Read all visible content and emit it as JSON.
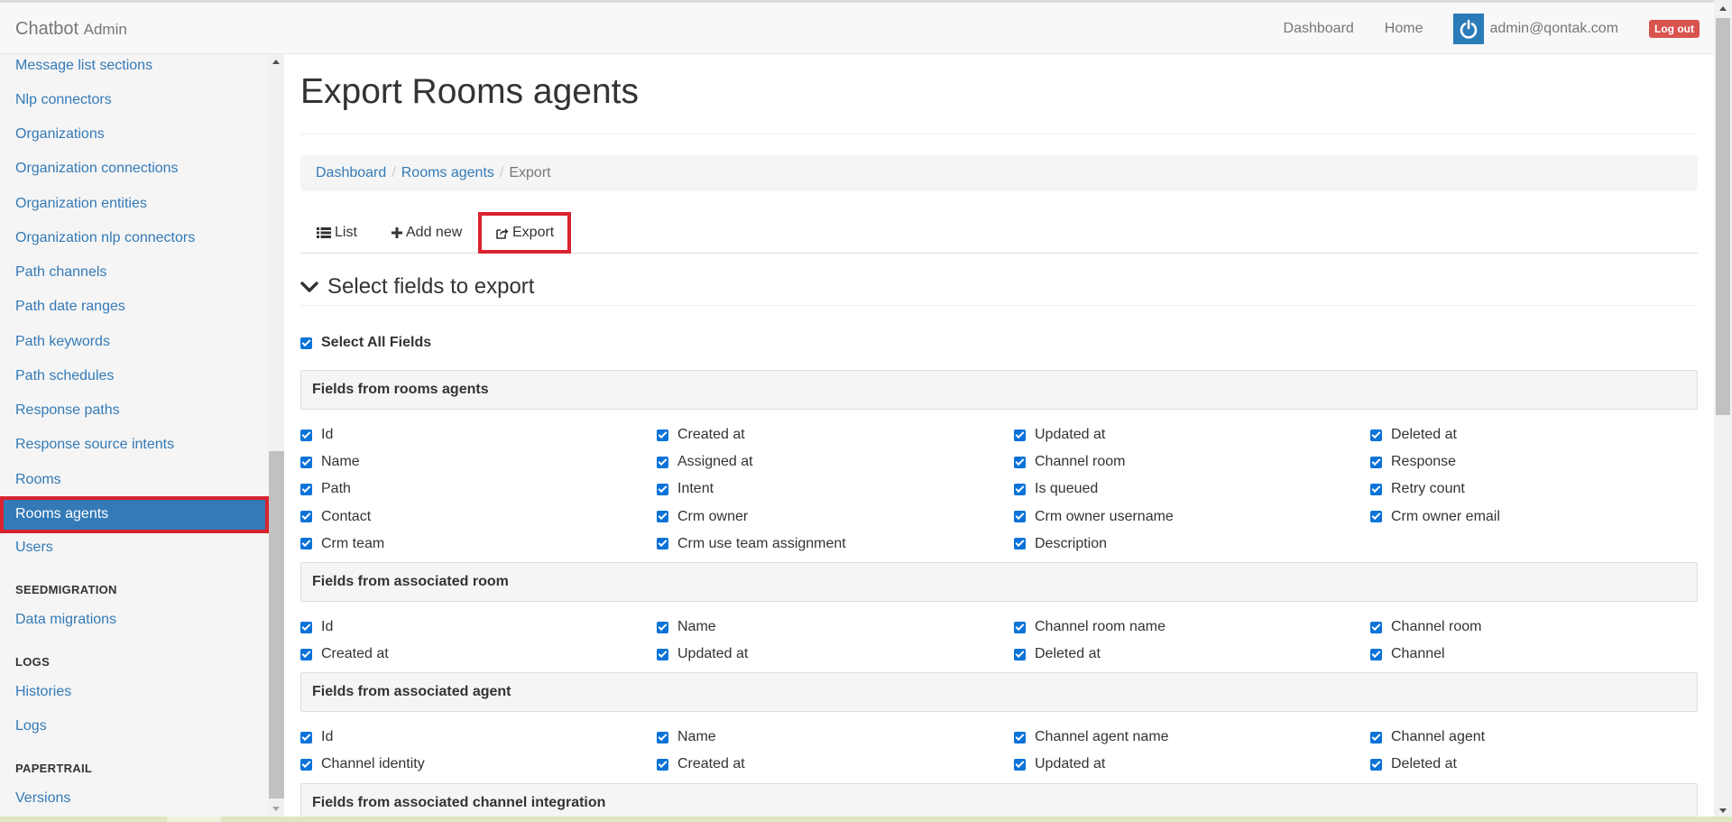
{
  "navbar": {
    "brand": "Chatbot",
    "brand_sub": "Admin",
    "links": [
      "Dashboard",
      "Home"
    ],
    "user_email": "admin@qontak.com",
    "logout": "Log out"
  },
  "sidebar": {
    "items": [
      "Message list sections",
      "Nlp connectors",
      "Organizations",
      "Organization connections",
      "Organization entities",
      "Organization nlp connectors",
      "Path channels",
      "Path date ranges",
      "Path keywords",
      "Path schedules",
      "Response paths",
      "Response source intents",
      "Rooms"
    ],
    "active": "Rooms agents",
    "after_active": [
      "Users"
    ],
    "groups": [
      {
        "header": "SEEDMIGRATION",
        "items": [
          "Data migrations"
        ]
      },
      {
        "header": "LOGS",
        "items": [
          "Histories",
          "Logs"
        ]
      },
      {
        "header": "PAPERTRAIL",
        "items": [
          "Versions"
        ]
      }
    ]
  },
  "main": {
    "title": "Export Rooms agents",
    "breadcrumb": [
      "Dashboard",
      "Rooms agents",
      "Export"
    ],
    "tabs": {
      "list": "List",
      "add_new": "Add new",
      "export": "Export"
    },
    "section_title": "Select fields to export",
    "select_all": "Select All Fields",
    "panels": [
      {
        "title": "Fields from rooms agents",
        "fields": [
          "Id",
          "Created at",
          "Updated at",
          "Deleted at",
          "Name",
          "Assigned at",
          "Channel room",
          "Response",
          "Path",
          "Intent",
          "Is queued",
          "Retry count",
          "Contact",
          "Crm owner",
          "Crm owner username",
          "Crm owner email",
          "Crm team",
          "Crm use team assignment",
          "Description"
        ]
      },
      {
        "title": "Fields from associated room",
        "fields": [
          "Id",
          "Name",
          "Channel room name",
          "Channel room",
          "Created at",
          "Updated at",
          "Deleted at",
          "Channel"
        ]
      },
      {
        "title": "Fields from associated agent",
        "fields": [
          "Id",
          "Name",
          "Channel agent name",
          "Channel agent",
          "Channel identity",
          "Created at",
          "Updated at",
          "Deleted at"
        ]
      },
      {
        "title": "Fields from associated channel integration",
        "fields": []
      }
    ]
  },
  "colors": {
    "accent": "#337ab7",
    "highlight_border": "#d9232e",
    "checkbox": "#0b73d8",
    "logout": "#d9534f"
  }
}
